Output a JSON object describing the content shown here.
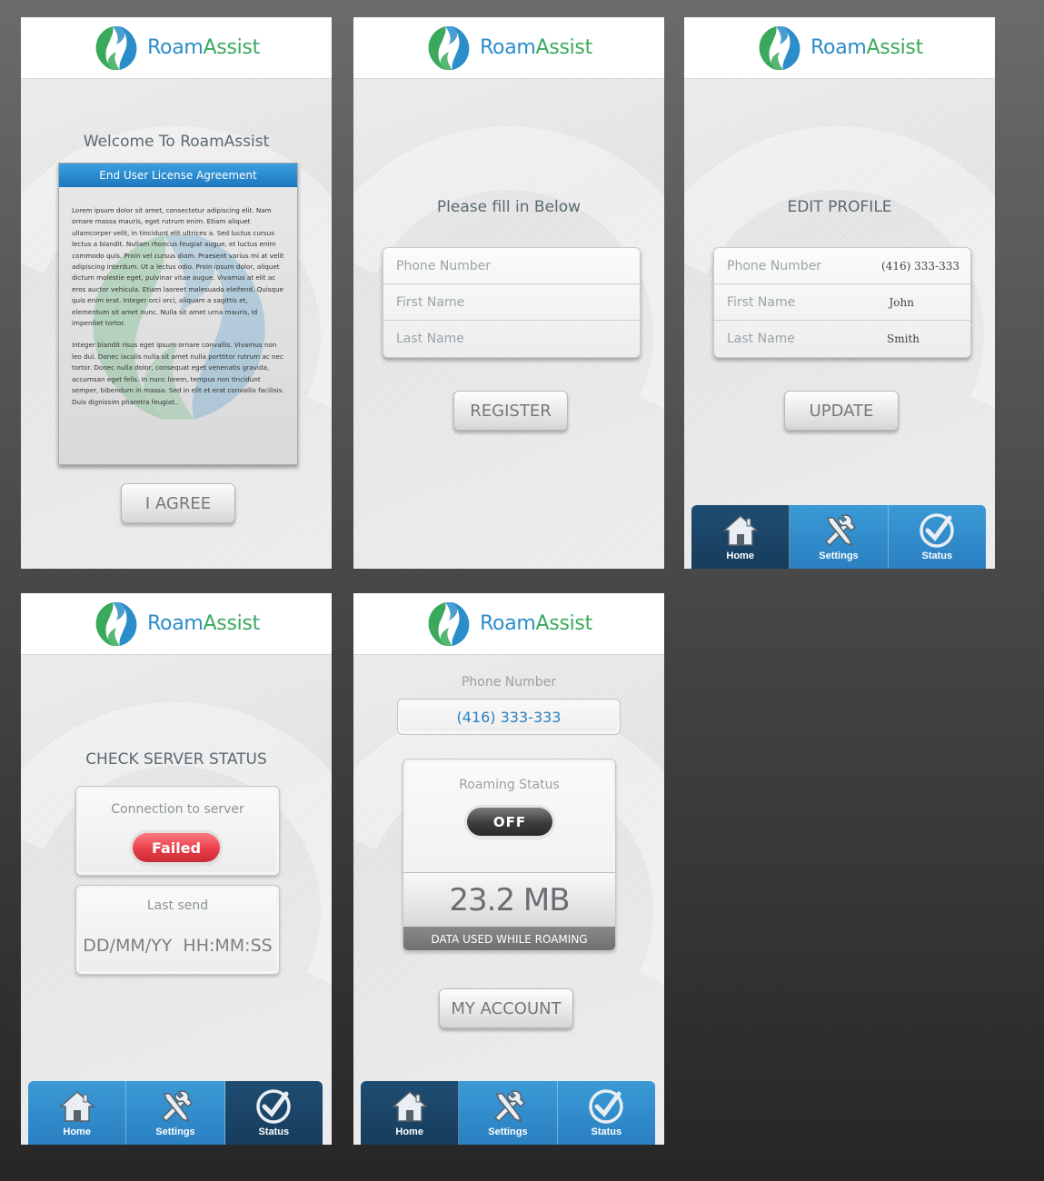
{
  "brand": {
    "name_part1": "Roam",
    "name_part2": "Assist"
  },
  "colors": {
    "accent_blue": "#2b8dc9",
    "accent_green": "#3aa95c",
    "tab_active": "#163c5c",
    "failed_red": "#e8404a"
  },
  "tabs": [
    {
      "label": "Home",
      "icon": "home-icon"
    },
    {
      "label": "Settings",
      "icon": "tools-icon"
    },
    {
      "label": "Status",
      "icon": "check-circle-icon"
    }
  ],
  "screen_eula": {
    "title": "Welcome To RoamAssist",
    "header": "End User License Agreement",
    "paragraph1": "Lorem ipsum dolor sit amet, consectetur adipiscing elit. Nam ornare massa mauris, eget rutrum enim. Etiam aliquet ullamcorper velit, in tincidunt elit ultrices a. Sed luctus cursus lectus a blandit. Nullam rhoncus feugiat augue, et luctus enim commodo quis. Proin vel cursus diam. Praesent varius mi at velit adipiscing interdum. Ut a lectus odio. Proin ipsum dolor, aliquet dictum molestie eget, pulvinar vitae augue. Vivamus at elit ac eros auctor vehicula. Etiam laoreet malesuada eleifend. Quisque quis enim erat. Integer orci orci, aliquam a sagittis et, elementum sit amet nunc. Nulla sit amet urna mauris, id imperdiet tortor.",
    "paragraph2": "Integer blandit risus eget ipsum ornare convallis. Vivamus non leo dui. Donec iaculis nulla sit amet nulla porttitor rutrum ac nec tortor. Donec nulla dolor, consequat eget venenatis gravida, accumsan eget felis. In nunc lorem, tempus non tincidunt semper, bibendum in massa. Sed in elit et erat convallis facilisis. Duis dignissim pharetra feugiat..",
    "agree_label": "I AGREE"
  },
  "screen_register": {
    "title": "Please fill in Below",
    "fields": {
      "phone": "Phone Number",
      "first": "First Name",
      "last": "Last Name"
    },
    "register_label": "REGISTER"
  },
  "screen_edit": {
    "title": "EDIT PROFILE",
    "fields": {
      "phone": "Phone Number",
      "phone_value": "(416) 333-333",
      "first": "First Name",
      "first_value": "John",
      "last": "Last Name",
      "last_value": "Smith"
    },
    "update_label": "UPDATE"
  },
  "screen_status": {
    "title": "CHECK SERVER STATUS",
    "connection_label": "Connection to server",
    "connection_value": "Failed",
    "last_send_label": "Last send",
    "last_send_value": "DD/MM/YY  HH:MM:SS"
  },
  "screen_home": {
    "phone_label": "Phone Number",
    "phone_value": "(416) 333-333",
    "roaming_label": "Roaming Status",
    "roaming_value": "OFF",
    "data_value": "23.2 MB",
    "data_caption": "DATA USED WHILE ROAMING",
    "account_label": "MY ACCOUNT"
  }
}
